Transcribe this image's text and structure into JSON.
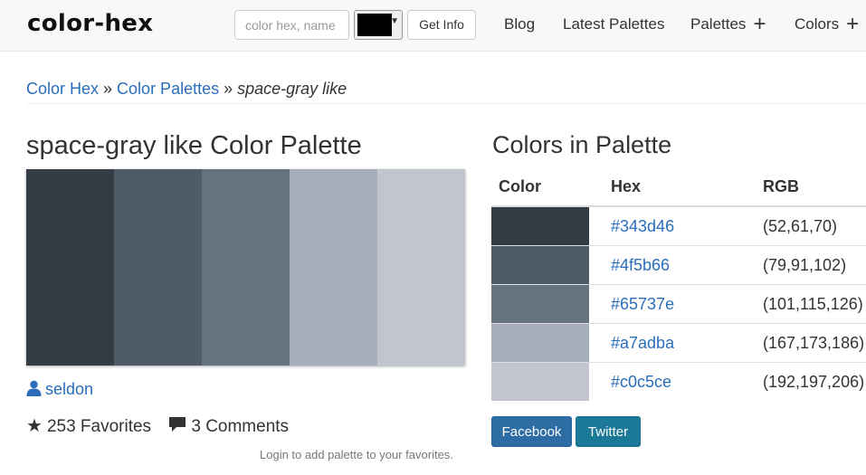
{
  "header": {
    "logo": "color-hex",
    "search_placeholder": "color hex, name",
    "picker_color": "#000000",
    "get_info_label": "Get Info",
    "nav": {
      "blog": "Blog",
      "latest": "Latest Palettes",
      "palettes": "Palettes",
      "colors": "Colors"
    }
  },
  "breadcrumb": {
    "home": "Color Hex",
    "sep": "»",
    "palettes": "Color Palettes",
    "current": "space-gray like"
  },
  "palette": {
    "title": "space-gray like Color Palette",
    "colors": [
      "#343d46",
      "#4f5b66",
      "#65737e",
      "#a7adba",
      "#c0c5ce"
    ],
    "author": "seldon",
    "favorites": "253 Favorites",
    "comments": "3 Comments",
    "login_note": "Login to add palette to your favorites."
  },
  "colors_section": {
    "title": "Colors in Palette",
    "headers": {
      "color": "Color",
      "hex": "Hex",
      "rgb": "RGB"
    },
    "rows": [
      {
        "hex": "#343d46",
        "rgb": "(52,61,70)"
      },
      {
        "hex": "#4f5b66",
        "rgb": "(79,91,102)"
      },
      {
        "hex": "#65737e",
        "rgb": "(101,115,126)"
      },
      {
        "hex": "#a7adba",
        "rgb": "(167,173,186)"
      },
      {
        "hex": "#c0c5ce",
        "rgb": "(192,197,206)"
      }
    ]
  },
  "share": {
    "facebook": "Facebook",
    "twitter": "Twitter"
  },
  "theme": {
    "link_color": "#2a6ebb",
    "facebook_color": "#2e6da4",
    "twitter_color": "#1b7896"
  }
}
